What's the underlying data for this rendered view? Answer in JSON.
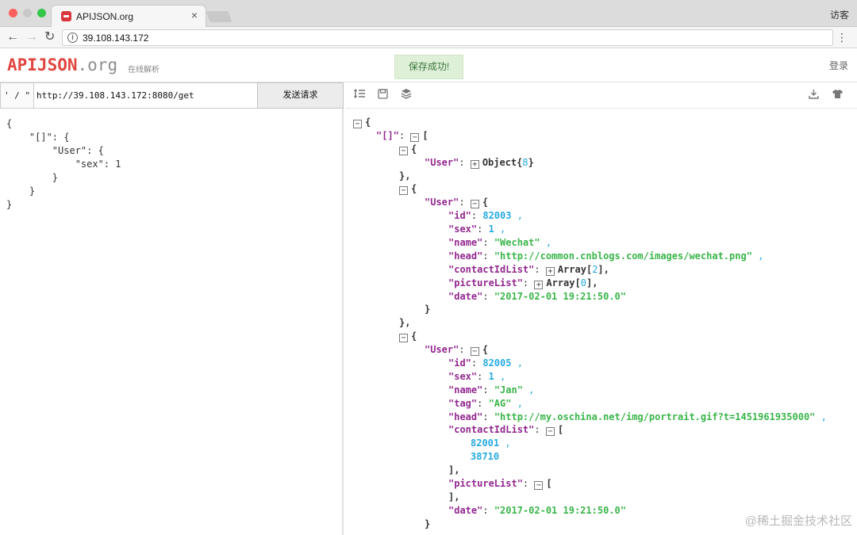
{
  "browser": {
    "tab_title": "APIJSON.org",
    "tab_close": "×",
    "profile": "访客",
    "address": "39.108.143.172",
    "back": "←",
    "forward": "→",
    "reload": "↻",
    "menu": "⋮"
  },
  "header": {
    "logo_main": "APIJSON",
    "logo_suffix": ".org",
    "subtitle": "在线解析",
    "toast": "保存成功!",
    "login": "登录"
  },
  "request": {
    "quote_toggle": "' / \"",
    "url": "http://39.108.143.172:8080/get",
    "send_label": "发送请求",
    "body_lines": [
      "{",
      "    \"[]\": {",
      "        \"User\": {",
      "            \"sex\": 1",
      "        }",
      "    }",
      "}"
    ]
  },
  "response_toolbar": {
    "icons": [
      "format-icon",
      "save-icon",
      "layers-icon",
      "download-icon",
      "tshirt-icon"
    ]
  },
  "response": {
    "root_open": "{",
    "array_key": "\"[]\"",
    "array_open": "[",
    "items": [
      {
        "open": "{",
        "user_key": "\"User\"",
        "collapsed_label": "Object",
        "collapsed_count": "8",
        "close": "},"
      },
      {
        "open": "{",
        "user_key": "\"User\"",
        "fields": [
          {
            "key": "\"id\"",
            "value": "82003",
            "type": "n"
          },
          {
            "key": "\"sex\"",
            "value": "1",
            "type": "n"
          },
          {
            "key": "\"name\"",
            "value": "\"Wechat\"",
            "type": "s"
          },
          {
            "key": "\"head\"",
            "value": "\"http://common.cnblogs.com/images/wechat.png\"",
            "type": "s"
          },
          {
            "key": "\"contactIdList\"",
            "collapsed_label": "Array",
            "collapsed_count": "2"
          },
          {
            "key": "\"pictureList\"",
            "collapsed_label": "Array",
            "collapsed_count": "0"
          },
          {
            "key": "\"date\"",
            "value": "\"2017-02-01 19:21:50.0\"",
            "type": "s"
          }
        ],
        "close_inner": "}",
        "close": "},"
      },
      {
        "open": "{",
        "user_key": "\"User\"",
        "fields": [
          {
            "key": "\"id\"",
            "value": "82005",
            "type": "n"
          },
          {
            "key": "\"sex\"",
            "value": "1",
            "type": "n"
          },
          {
            "key": "\"name\"",
            "value": "\"Jan\"",
            "type": "s"
          },
          {
            "key": "\"tag\"",
            "value": "\"AG\"",
            "type": "s"
          },
          {
            "key": "\"head\"",
            "value": "\"http://my.oschina.net/img/portrait.gif?t=1451961935000\"",
            "type": "s"
          }
        ],
        "contact_key": "\"contactIdList\"",
        "contact_values": [
          "82001",
          "38710"
        ],
        "contact_close": "],",
        "picture_key": "\"pictureList\"",
        "picture_close": "],",
        "date_key": "\"date\"",
        "date_value": "\"2017-02-01 19:21:50.0\"",
        "close_inner": "}"
      }
    ]
  },
  "watermark": "@稀土掘金技术社区"
}
